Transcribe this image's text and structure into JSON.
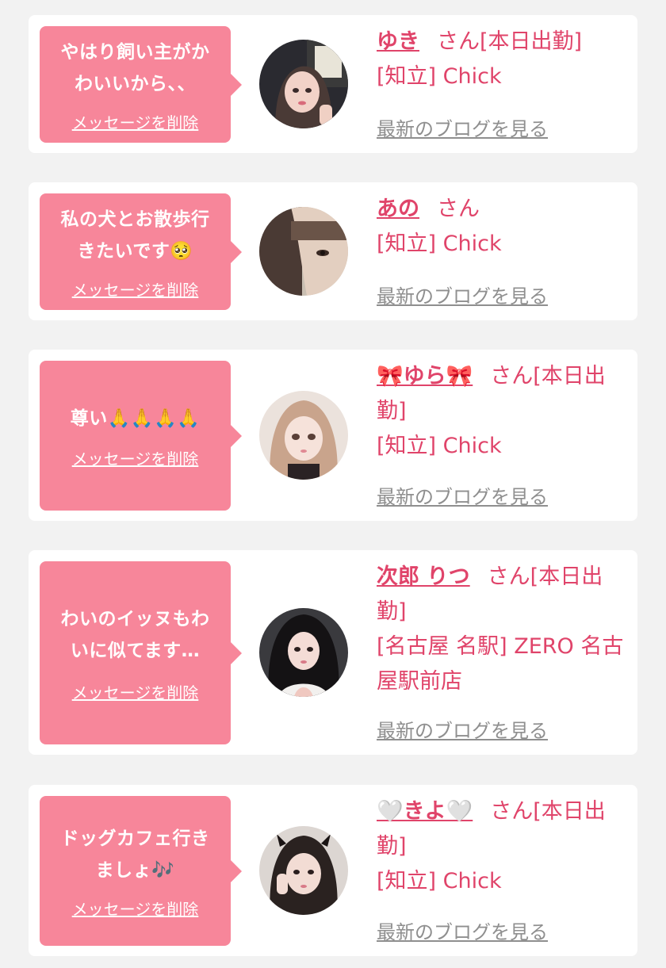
{
  "delete_label": "メッセージを削除",
  "blog_label": "最新のブログを見る",
  "colors": {
    "background": "#f2f2f2",
    "card": "#ffffff",
    "bubble": "#f7869a",
    "name_text": "#e0446a",
    "link_gray": "#8f8f8f"
  },
  "cards": [
    {
      "message_lines": [
        "やはり飼い主がか",
        "わいいから、、"
      ],
      "name": "ゆき",
      "suffix": "さん[本日出勤]",
      "shop": "[知立] Chick",
      "avatar_icon": "girl-photo-avatar"
    },
    {
      "message_lines": [
        "私の犬とお散歩行",
        "きたいです🥺"
      ],
      "name": "あの",
      "suffix": "さん",
      "shop": "[知立] Chick",
      "avatar_icon": "girl-photo-avatar"
    },
    {
      "message_lines": [
        "尊い🙏🙏🙏🙏"
      ],
      "name": "🎀ゆら🎀",
      "suffix": "さん[本日出勤]",
      "shop": "[知立] Chick",
      "avatar_icon": "girl-photo-avatar"
    },
    {
      "message_lines": [
        "わいのイッヌもわ",
        "いに似てます…"
      ],
      "name": "次郎 りつ",
      "suffix": "さん[本日出勤]",
      "shop": "[名古屋 名駅] ZERO 名古屋駅前店",
      "avatar_icon": "girl-photo-avatar"
    },
    {
      "message_lines": [
        "ドッグカフェ行き",
        "ましょ🎶"
      ],
      "name": "🤍きよ🤍",
      "suffix": "さん[本日出勤]",
      "shop": "[知立] Chick",
      "avatar_icon": "girl-photo-avatar"
    }
  ]
}
